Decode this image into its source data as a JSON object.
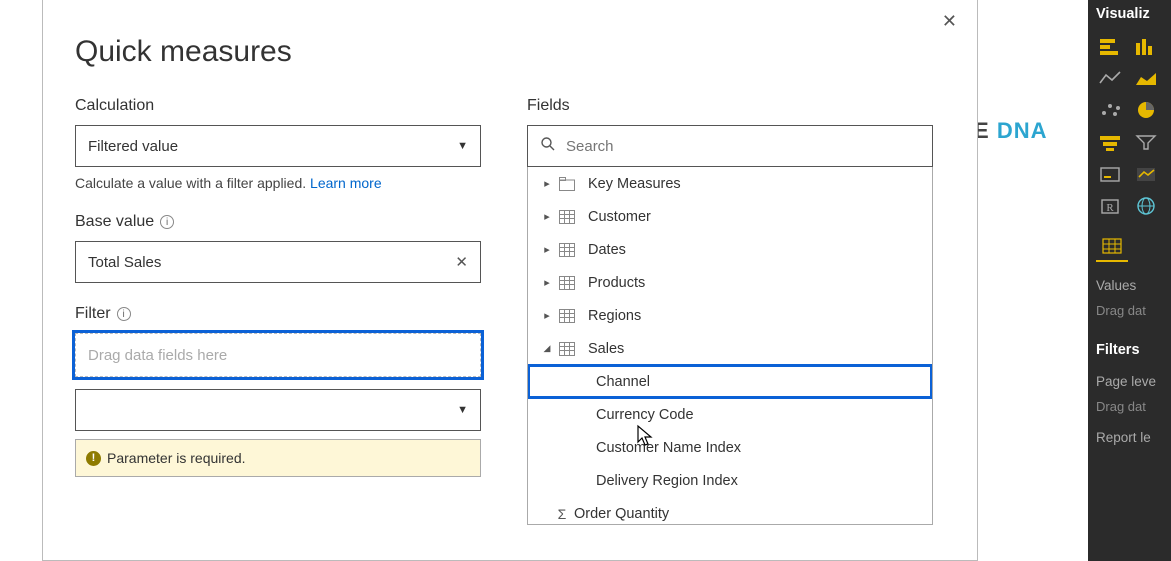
{
  "background": {
    "logo_part1": "E",
    "logo_part2": "DNA"
  },
  "dialog": {
    "title": "Quick measures",
    "close_glyph": "✕",
    "calculation": {
      "label": "Calculation",
      "selected": "Filtered value",
      "helper_text": "Calculate a value with a filter applied.  ",
      "learn_more": "Learn more"
    },
    "base_value": {
      "label": "Base value",
      "value": "Total Sales"
    },
    "filter": {
      "label": "Filter",
      "placeholder": "Drag data fields here",
      "error": "Parameter is required."
    },
    "fields": {
      "label": "Fields",
      "search_placeholder": "Search",
      "tree": [
        {
          "name": "Key Measures",
          "expanded": false,
          "icon": "folder"
        },
        {
          "name": "Customer",
          "expanded": false,
          "icon": "table"
        },
        {
          "name": "Dates",
          "expanded": false,
          "icon": "table"
        },
        {
          "name": "Products",
          "expanded": false,
          "icon": "table"
        },
        {
          "name": "Regions",
          "expanded": false,
          "icon": "table"
        },
        {
          "name": "Sales",
          "expanded": true,
          "icon": "table",
          "children": [
            {
              "name": "Channel",
              "icon": "none",
              "highlighted": true
            },
            {
              "name": "Currency Code",
              "icon": "none"
            },
            {
              "name": "Customer Name Index",
              "icon": "none"
            },
            {
              "name": "Delivery Region Index",
              "icon": "none"
            },
            {
              "name": "Order Quantity",
              "icon": "sigma"
            }
          ]
        }
      ]
    }
  },
  "vis_panel": {
    "title": "Visualiz",
    "icons": [
      "stacked-bar",
      "clustered-column",
      "line",
      "area",
      "scatter",
      "pie",
      "funnel",
      "filter",
      "card",
      "kpi",
      "r-script",
      "globe"
    ],
    "values_label": "Values",
    "drag_label": "Drag dat",
    "filters_title": "Filters",
    "page_level_label": "Page leve",
    "drag_label2": "Drag dat",
    "report_level_label": "Report le"
  }
}
